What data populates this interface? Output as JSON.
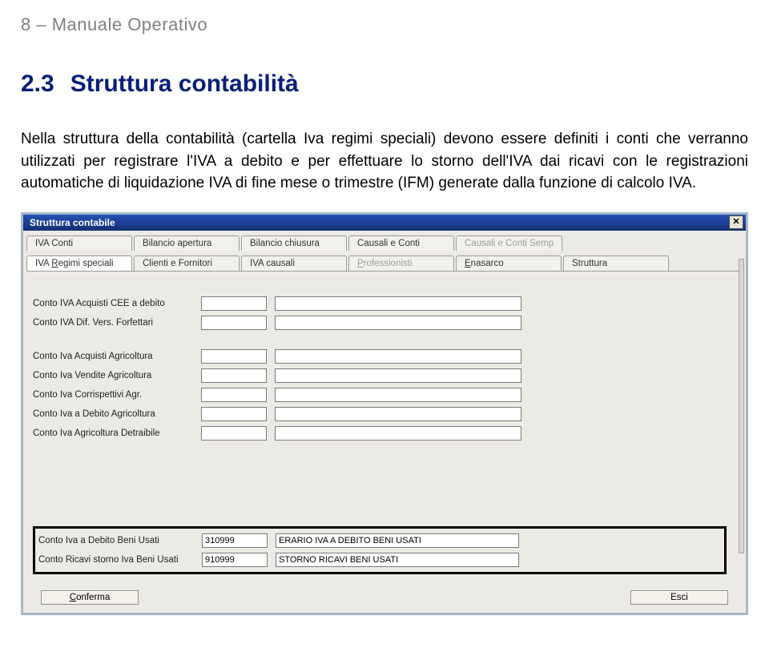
{
  "page": {
    "header": "8  –  Manuale Operativo",
    "heading_num": "2.3",
    "heading_title": "Struttura contabilità",
    "body": "Nella struttura della contabilità (cartella Iva regimi speciali) devono essere definiti i conti che verranno utilizzati per registrare l'IVA a debito e per effettuare lo storno dell'IVA dai ricavi con le registrazioni automatiche di liquidazione IVA di fine mese o trimestre (IFM) generate dalla funzione di calcolo IVA."
  },
  "dlg": {
    "title": "Struttura contabile",
    "tabs_row1": [
      {
        "label": "IVA Conti",
        "disabled": false
      },
      {
        "label": "Bilancio apertura",
        "disabled": false
      },
      {
        "label": "Bilancio chiusura",
        "disabled": false
      },
      {
        "label": "Causali e Conti",
        "disabled": false
      },
      {
        "label": "Causali e Conti Semp",
        "disabled": true
      }
    ],
    "tabs_row2": [
      {
        "label": "IVA Regimi speciali",
        "active": true
      },
      {
        "label": "Clienti e Fornitori"
      },
      {
        "label": "IVA causali"
      },
      {
        "label": "Professionisti",
        "disabled": true
      },
      {
        "label": "Enasarco"
      },
      {
        "label": "Struttura"
      }
    ],
    "fields_top": [
      {
        "label": "Conto IVA Acquisti CEE a debito",
        "code": "",
        "desc": ""
      },
      {
        "label": "Conto IVA Dif. Vers. Forfettari",
        "code": "",
        "desc": ""
      }
    ],
    "fields_agri": [
      {
        "label": "Conto Iva Acquisti Agricoltura",
        "code": "",
        "desc": ""
      },
      {
        "label": "Conto Iva Vendite Agricoltura",
        "code": "",
        "desc": ""
      },
      {
        "label": "Conto Iva Corrispettivi Agr.",
        "code": "",
        "desc": ""
      },
      {
        "label": "Conto Iva a Debito Agricoltura",
        "code": "",
        "desc": ""
      },
      {
        "label": "Conto Iva Agricoltura Detraibile",
        "code": "",
        "desc": ""
      }
    ],
    "fields_highlight": [
      {
        "label": "Conto Iva a Debito Beni Usati",
        "code": "310999",
        "desc": "ERARIO IVA A DEBITO BENI USATI"
      },
      {
        "label": "Conto Ricavi storno Iva Beni Usati",
        "code": "910999",
        "desc": "STORNO RICAVI BENI USATI"
      }
    ],
    "confirm": "Conferma",
    "esc": "Esci"
  }
}
